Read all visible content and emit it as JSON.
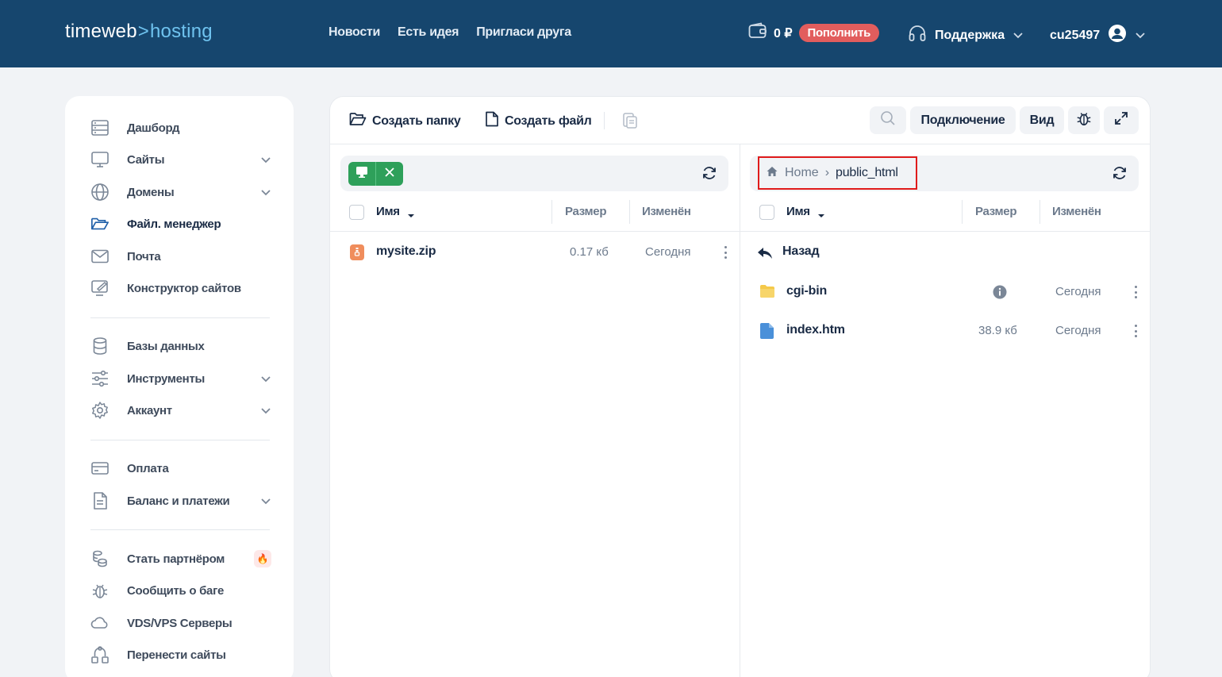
{
  "header": {
    "logo_part1": "timeweb",
    "logo_arrow": ">",
    "logo_part2": "hosting",
    "nav": [
      "Новости",
      "Есть идея",
      "Пригласи друга"
    ],
    "balance": "0 ₽",
    "topup_label": "Пополнить",
    "support_label": "Поддержка",
    "username": "cu25497"
  },
  "sidebar": {
    "items": [
      {
        "label": "Дашборд",
        "icon": "dashboard-icon"
      },
      {
        "label": "Сайты",
        "icon": "monitor-icon"
      },
      {
        "label": "Домены",
        "icon": "globe-icon"
      },
      {
        "label": "Файл. менеджер",
        "icon": "folder-icon"
      },
      {
        "label": "Почта",
        "icon": "mail-icon"
      },
      {
        "label": "Конструктор сайтов",
        "icon": "site-builder-icon"
      },
      {
        "label": "Базы данных",
        "icon": "database-icon"
      },
      {
        "label": "Инструменты",
        "icon": "sliders-icon"
      },
      {
        "label": "Аккаунт",
        "icon": "gear-icon"
      },
      {
        "label": "Оплата",
        "icon": "credit-card-icon"
      },
      {
        "label": "Баланс и платежи",
        "icon": "document-icon"
      },
      {
        "label": "Стать партнёром",
        "icon": "coins-icon"
      },
      {
        "label": "Сообщить о баге",
        "icon": "bug-icon"
      },
      {
        "label": "VDS/VPS Серверы",
        "icon": "cloud-icon"
      },
      {
        "label": "Перенести сайты",
        "icon": "transfer-icon"
      }
    ],
    "fire_badge": "🔥"
  },
  "toolbar": {
    "create_folder": "Создать папку",
    "create_file": "Создать файл",
    "connection": "Подключение",
    "view": "Вид"
  },
  "columns": {
    "name": "Имя",
    "size": "Размер",
    "modified": "Изменён"
  },
  "left_pane": {
    "files": [
      {
        "name": "mysite.zip",
        "size": "0.17 кб",
        "modified": "Сегодня",
        "icon": "archive-icon"
      }
    ]
  },
  "right_pane": {
    "breadcrumb": {
      "home": "Home",
      "separator": "›",
      "current": "public_html"
    },
    "back_label": "Назад",
    "files": [
      {
        "name": "cgi-bin",
        "size": "",
        "modified": "Сегодня",
        "icon": "folder-icon"
      },
      {
        "name": "index.htm",
        "size": "38.9 кб",
        "modified": "Сегодня",
        "icon": "file-icon"
      }
    ]
  },
  "colors": {
    "header_bg": "#16466e",
    "accent_green": "#2ea05a",
    "topup_red": "#e25d5d",
    "highlight_red": "#e01b1b"
  }
}
